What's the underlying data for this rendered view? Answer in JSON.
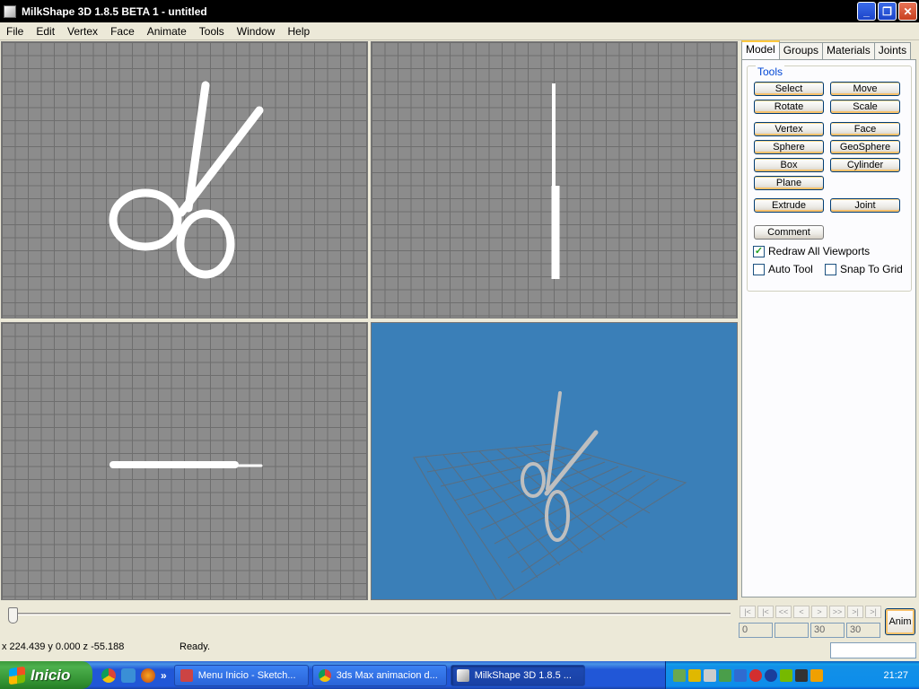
{
  "window": {
    "title": "MilkShape 3D 1.8.5 BETA 1 - untitled",
    "minimize": "_",
    "maximize": "❐",
    "close": "✕"
  },
  "menu": [
    "File",
    "Edit",
    "Vertex",
    "Face",
    "Animate",
    "Tools",
    "Window",
    "Help"
  ],
  "panel": {
    "tabs": [
      "Model",
      "Groups",
      "Materials",
      "Joints"
    ],
    "active_tab": "Model",
    "group_label": "Tools",
    "buttons": {
      "select": "Select",
      "move": "Move",
      "rotate": "Rotate",
      "scale": "Scale",
      "vertex": "Vertex",
      "face": "Face",
      "sphere": "Sphere",
      "geosphere": "GeoSphere",
      "box": "Box",
      "cylinder": "Cylinder",
      "plane": "Plane",
      "extrude": "Extrude",
      "joint": "Joint",
      "comment": "Comment"
    },
    "checkboxes": {
      "redraw_all": {
        "label": "Redraw All Viewports",
        "checked": true
      },
      "auto_tool": {
        "label": "Auto Tool",
        "checked": false
      },
      "snap_to_grid": {
        "label": "Snap To Grid",
        "checked": false
      }
    }
  },
  "timeline": {
    "nav": [
      "|<",
      "|<",
      "<<",
      "<",
      ">",
      ">>",
      ">|",
      ">|"
    ],
    "frame_field": "0",
    "field2": "",
    "field3": "30",
    "field4": "30",
    "anim_button": "Anim"
  },
  "status": {
    "coords": "x 224.439 y 0.000 z -55.188",
    "message": "Ready."
  },
  "taskbar": {
    "start": "Inicio",
    "chevron": "»",
    "tasks": [
      {
        "label": "Menu Inicio - Sketch...",
        "active": false
      },
      {
        "label": "3ds Max animacion d...",
        "active": false
      },
      {
        "label": "MilkShape 3D 1.8.5 ...",
        "active": true
      }
    ],
    "clock": "21:27"
  },
  "colors": {
    "ortho_bg": "#8c8c8c",
    "persp_bg": "#3a7fb8",
    "model": "#ffffff"
  }
}
